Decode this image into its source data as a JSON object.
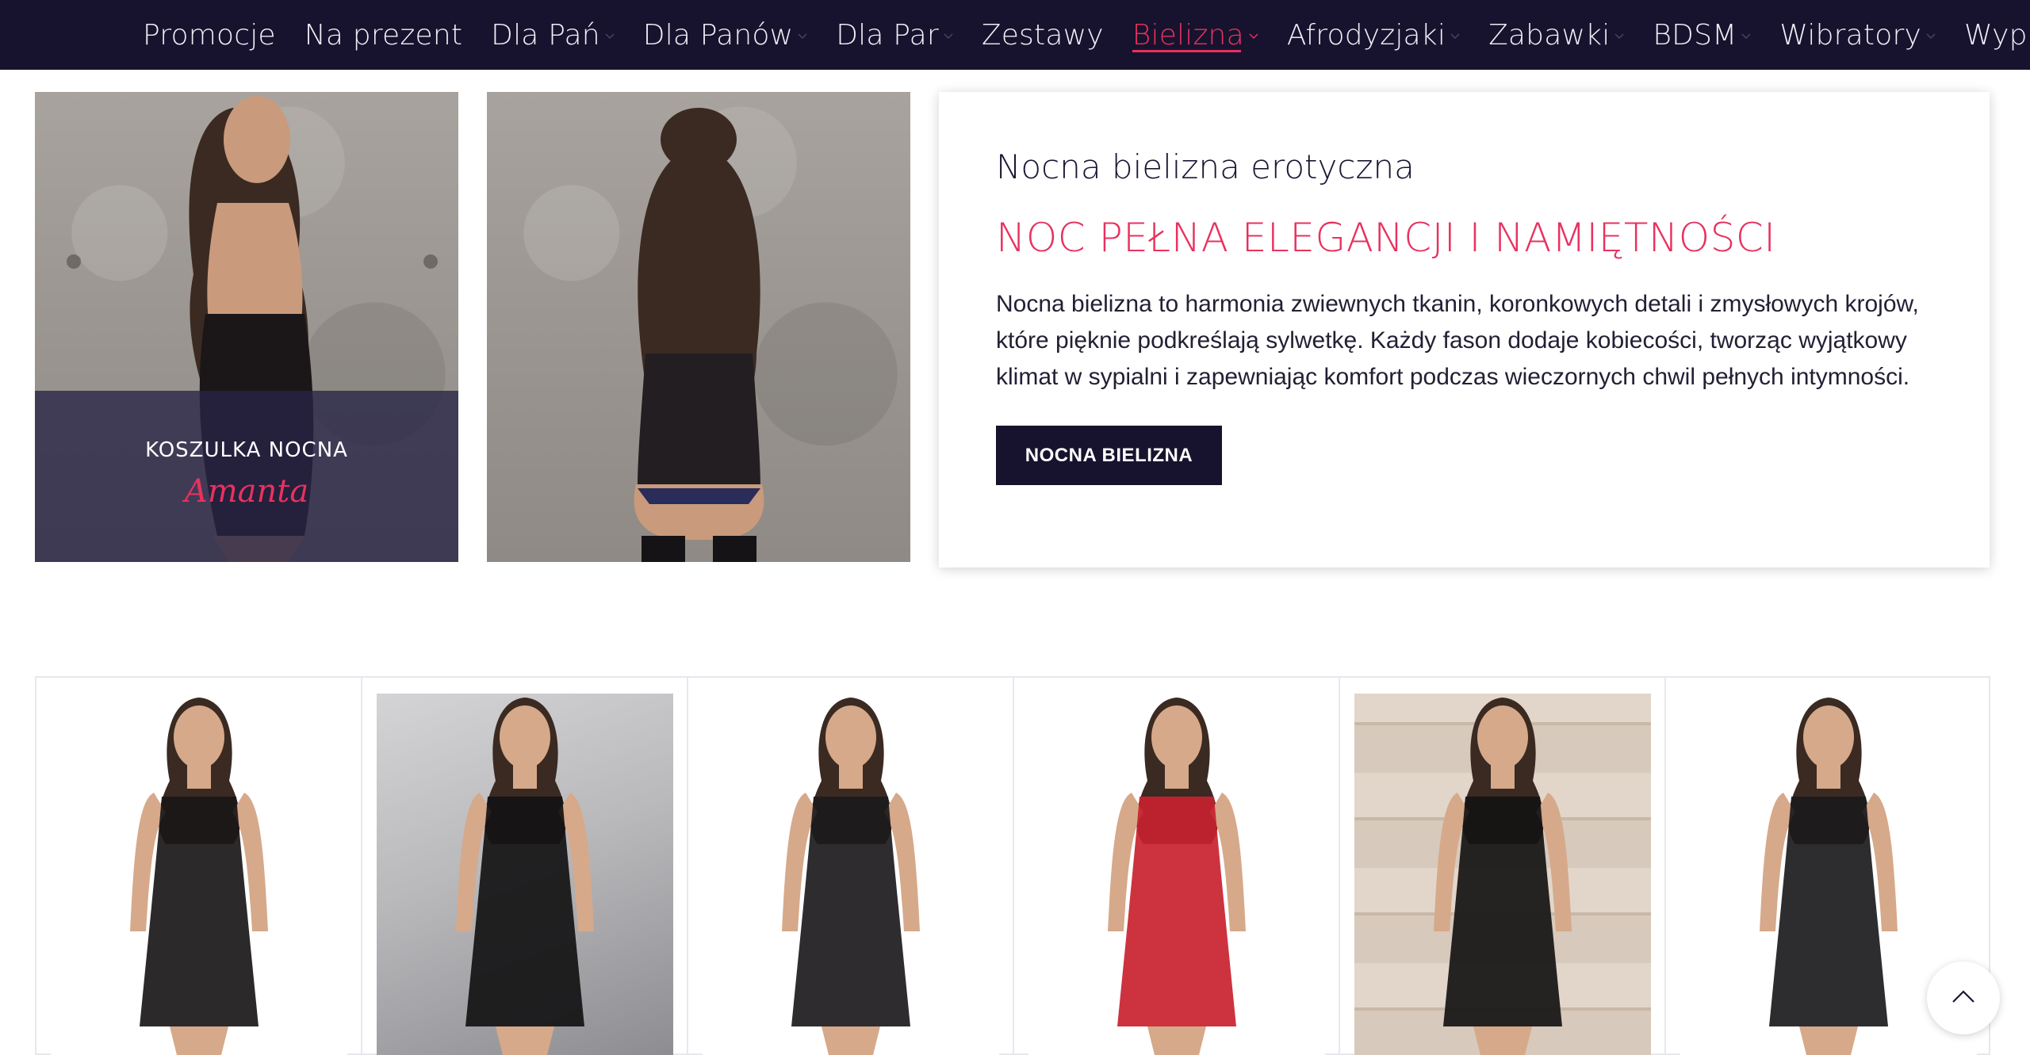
{
  "nav": {
    "items": [
      {
        "label": "Promocje",
        "dropdown": false,
        "active": false
      },
      {
        "label": "Na prezent",
        "dropdown": false,
        "active": false
      },
      {
        "label": "Dla Pań",
        "dropdown": true,
        "active": false
      },
      {
        "label": "Dla Panów",
        "dropdown": true,
        "active": false
      },
      {
        "label": "Dla Par",
        "dropdown": true,
        "active": false
      },
      {
        "label": "Zestawy",
        "dropdown": false,
        "active": false
      },
      {
        "label": "Bielizna",
        "dropdown": true,
        "active": true
      },
      {
        "label": "Afrodyzjaki",
        "dropdown": true,
        "active": false
      },
      {
        "label": "Zabawki",
        "dropdown": true,
        "active": false
      },
      {
        "label": "BDSM",
        "dropdown": true,
        "active": false
      },
      {
        "label": "Wibratory",
        "dropdown": true,
        "active": false
      },
      {
        "label": "Wyprzedaż",
        "dropdown": false,
        "active": false
      }
    ],
    "chevron_icon": "chevron-down-icon"
  },
  "hero": {
    "card_one": {
      "kicker": "KOSZULKA NOCNA",
      "name": "Amanta"
    }
  },
  "info": {
    "subtitle": "Nocna bielizna erotyczna",
    "heading": "NOC PEŁNA ELEGANCJI I NAMIĘTNOŚCI",
    "description": "Nocna bielizna to harmonia zwiewnych tkanin, koronkowych detali i zmysłowych krojów, które pięknie podkreślają sylwetkę. Każdy fason dodaje kobiecości, tworząc wyjątkowy klimat w sypialni i zapewniając komfort podczas wieczornych chwil pełnych intymności.",
    "cta_label": "NOCNA BIELIZNA"
  },
  "products": [
    {
      "background": "white",
      "garment_color": "#1a1718"
    },
    {
      "background": "grey",
      "garment_color": "#141214"
    },
    {
      "background": "white",
      "garment_color": "#1c1a1c"
    },
    {
      "background": "white",
      "garment_color": "#c8222f"
    },
    {
      "background": "beige",
      "garment_color": "#151314"
    },
    {
      "background": "white",
      "garment_color": "#1b1a1c"
    }
  ],
  "colors": {
    "nav_bg": "#17132e",
    "accent": "#e7325f",
    "cta_bg": "#17132e"
  },
  "scroll_top_icon": "chevron-up-icon"
}
